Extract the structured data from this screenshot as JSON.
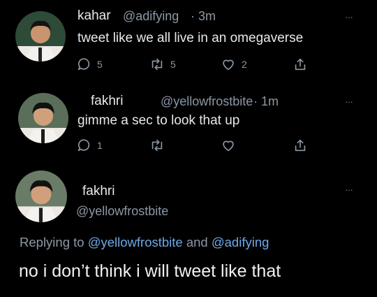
{
  "tweets": [
    {
      "name": "kahar",
      "handle": "@adifying",
      "time": "· 3m",
      "text": "tweet like we all live in an omegaverse",
      "more": "···",
      "actions": {
        "reply": "5",
        "retweet": "5",
        "like": "2"
      },
      "icons": {
        "reply": "reply-icon",
        "retweet": "retweet-icon",
        "like": "heart-icon",
        "share": "share-icon"
      }
    },
    {
      "name": "fakhri",
      "handle": "@yellowfrostbite",
      "time": "· 1m",
      "text": "gimme a sec to look that up",
      "more": "···",
      "actions": {
        "reply": "1",
        "retweet": "",
        "like": ""
      }
    }
  ],
  "main": {
    "name": "fakhri",
    "handle": "@yellowfrostbite",
    "more": "···",
    "replying_prefix": "Replying to",
    "replying_user1": "@yellowfrostbite",
    "replying_and": "and",
    "replying_user2": "@adifying",
    "text": "no i don’t think i will tweet like that"
  },
  "colors": {
    "background": "#000000",
    "link": "#6ca9e8",
    "muted": "#8b98a5"
  }
}
